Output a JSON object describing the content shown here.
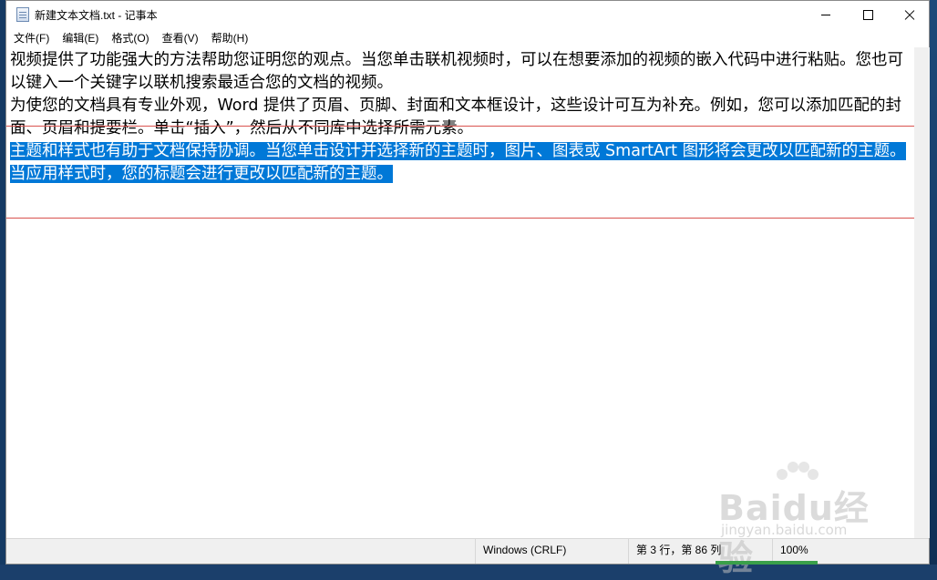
{
  "window": {
    "title": "新建文本文档.txt - 记事本"
  },
  "menu": {
    "items": [
      "文件(F)",
      "编辑(E)",
      "格式(O)",
      "查看(V)",
      "帮助(H)"
    ]
  },
  "document": {
    "line1": "视频提供了功能强大的方法帮助您证明您的观点。当您单击联机视频时，可以在想要添加的视频的嵌入代码中进行粘贴。您也可以键入一个关键字以联机搜索最适合您的文档的视频。",
    "line2": "为使您的文档具有专业外观，Word 提供了页眉、页脚、封面和文本框设计，这些设计可互为补充。例如，您可以添加匹配的封面、页眉和提要栏。单击“插入”，然后从不同库中选择所需元素。",
    "line3_selected": "主题和样式也有助于文档保持协调。当您单击设计并选择新的主题时，图片、图表或 SmartArt 图形将会更改以匹配新的主题。当应用样式时，您的标题会进行更改以匹配新的主题。"
  },
  "status": {
    "encoding": "Windows (CRLF)",
    "position": "第 3 行，第 86 列",
    "zoom": "100%"
  },
  "watermark": {
    "brand": "Baidu经验",
    "url": "jingyan.baidu.com"
  },
  "colors": {
    "selection": "#0078d7",
    "annotation_box": "#d9534f",
    "desktop": "#1b3f6b"
  }
}
